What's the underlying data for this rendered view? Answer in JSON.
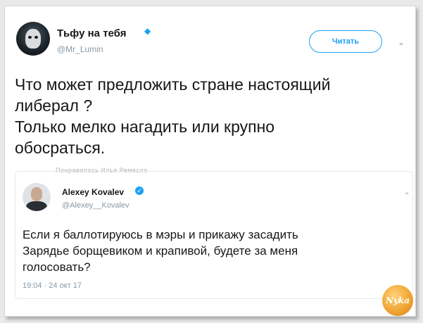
{
  "tweet": {
    "author_name": "Тьфу на тебя",
    "author_handle": "@Mr_Lumin",
    "read_button": "Читать",
    "text": "Что может предложить стране настоящий\nлиберал ?\nТолько мелко нагадить или крупно\nобосраться.",
    "cut_text": "Понравилось Илья Ремесло"
  },
  "quoted_tweet": {
    "author_name": "Alexey Kovalev",
    "author_handle": "@Alexey__Kovalev",
    "text": "Если я баллотируюсь в мэры и прикажу засадить\nЗарядье борщевиком и крапивой, будете за меня\nголосовать?",
    "timestamp": "19:04 · 24 окт 17"
  },
  "watermark": {
    "text": "Nyka"
  },
  "icons": {
    "verified": "verified-check-icon",
    "caret": "chevron-down-icon"
  },
  "colors": {
    "accent": "#1da1f2",
    "text": "#14171a",
    "muted": "#8899a6",
    "border": "#e1e8ed",
    "badge": "#f0a634"
  }
}
